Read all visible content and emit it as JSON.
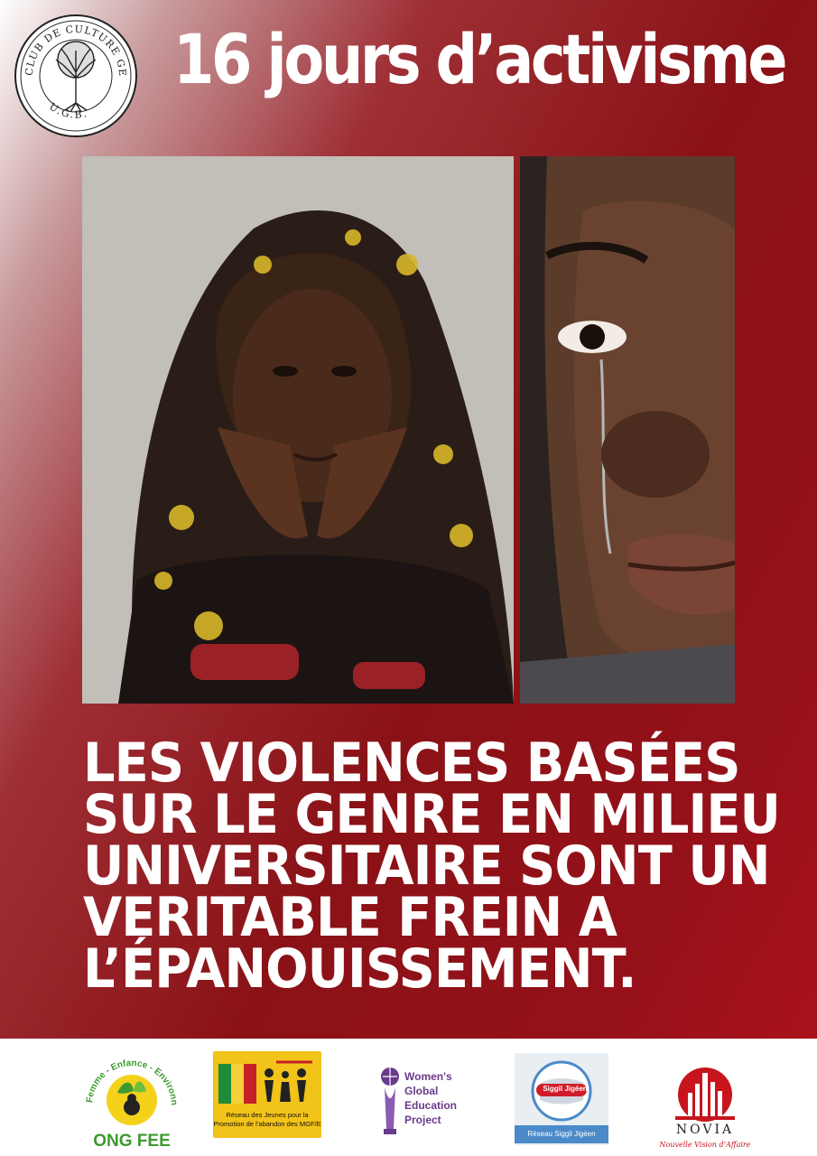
{
  "header": {
    "title": "16 jours d’activisme",
    "club_logo": {
      "ring_text": "CLUB DE CULTURE GENERALE",
      "initials": "U.G.B.",
      "icon": "tree-icon"
    }
  },
  "photos": {
    "left": {
      "icon": "girl-in-headscarf-photo"
    },
    "right": {
      "icon": "crying-woman-photo"
    }
  },
  "headline": {
    "lines": [
      "LES VIOLENCES BASÉES",
      "SUR LE GENRE EN MILIEU",
      "UNIVERSITAIRE SONT UN",
      "VERITABLE FREIN A",
      "L’ÉPANOUISSEMENT."
    ]
  },
  "partners": {
    "ong_fee": {
      "ring_text": "Femme - Enfance - Environnement",
      "name": "ONG FEE"
    },
    "reseau_jeunes": {
      "caption_1": "Réseau des Jeunes pour la",
      "caption_2": "Promotion de l’abandon des MGF/E"
    },
    "womens_global": {
      "line_1": "Women's",
      "line_2": "Global",
      "line_3": "Education",
      "line_4": "Project"
    },
    "reseau_siggil": {
      "badge": "Siggil Jigéen",
      "caption": "Réseau Siggil Jigéen"
    },
    "novia": {
      "name": "NOVIA",
      "tagline": "Nouvelle Vision d’Affaire"
    }
  },
  "colors": {
    "background_red": "#8a1216",
    "title_white": "#ffffff",
    "footer_white": "#ffffff",
    "ong_green": "#3d9a2e",
    "womens_purple": "#6a3a8c",
    "novia_red": "#c8141d"
  }
}
